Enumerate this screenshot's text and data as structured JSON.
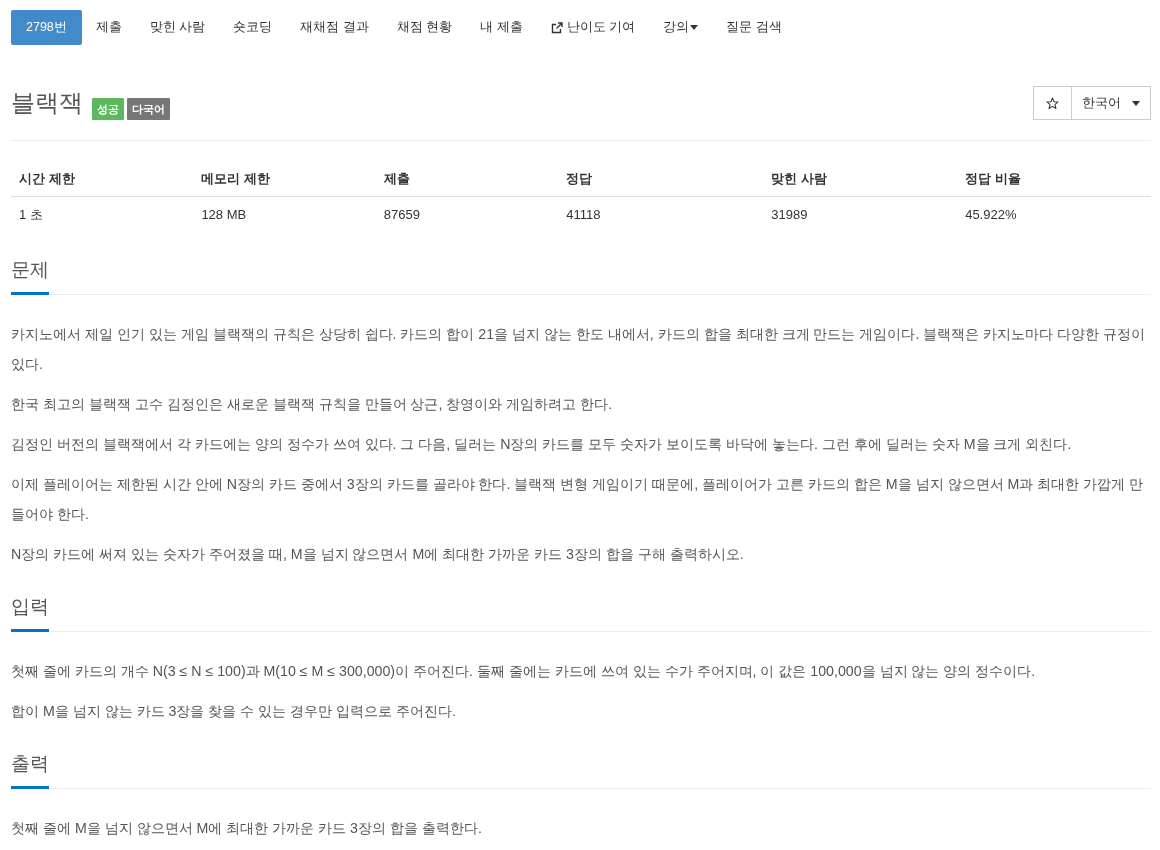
{
  "nav_tabs": [
    {
      "label": "2798번",
      "kind": "link",
      "selected": true
    },
    {
      "label": "제출",
      "kind": "link",
      "selected": false
    },
    {
      "label": "맞힌 사람",
      "kind": "link",
      "selected": false
    },
    {
      "label": "숏코딩",
      "kind": "link",
      "selected": false
    },
    {
      "label": "재채점 결과",
      "kind": "link",
      "selected": false
    },
    {
      "label": "채점 현황",
      "kind": "link",
      "selected": false
    },
    {
      "label": "내 제출",
      "kind": "link",
      "selected": false
    },
    {
      "label": "난이도 기여",
      "kind": "external",
      "selected": false
    },
    {
      "label": "강의",
      "kind": "dropdown",
      "selected": false
    },
    {
      "label": "질문 검색",
      "kind": "link",
      "selected": false
    }
  ],
  "problem_header": {
    "title": "블랙잭",
    "labels": [
      {
        "text": "성공",
        "color": "#5cb85c"
      },
      {
        "text": "다국어",
        "color": "#777777"
      }
    ],
    "star_button": {
      "starred": false
    },
    "language_select": {
      "value": "한국어"
    }
  },
  "info_table": {
    "columns": [
      "시간 제한",
      "메모리 제한",
      "제출",
      "정답",
      "맞힌 사람",
      "정답 비율"
    ],
    "rows": [
      [
        "1 초",
        "128 MB",
        "87659",
        "41118",
        "31989",
        "45.922%"
      ]
    ]
  },
  "sections": [
    {
      "heading": "문제",
      "paragraphs": [
        "카지노에서 제일 인기 있는 게임 블랙잭의 규칙은 상당히 쉽다. 카드의 합이 21을 넘지 않는 한도 내에서, 카드의 합을 최대한 크게 만드는 게임이다. 블랙잭은 카지노마다 다양한 규정이 있다.",
        "한국 최고의 블랙잭 고수 김정인은 새로운 블랙잭 규칙을 만들어 상근, 창영이와 게임하려고 한다.",
        "김정인 버전의 블랙잭에서 각 카드에는 양의 정수가 쓰여 있다. 그 다음, 딜러는 N장의 카드를 모두 숫자가 보이도록 바닥에 놓는다. 그런 후에 딜러는 숫자 M을 크게 외친다.",
        "이제 플레이어는 제한된 시간 안에 N장의 카드 중에서 3장의 카드를 골라야 한다. 블랙잭 변형 게임이기 때문에, 플레이어가 고른 카드의 합은 M을 넘지 않으면서 M과 최대한 가깝게 만들어야 한다.",
        "N장의 카드에 써져 있는 숫자가 주어졌을 때, M을 넘지 않으면서 M에 최대한 가까운 카드 3장의 합을 구해 출력하시오."
      ]
    },
    {
      "heading": "입력",
      "paragraphs": [
        "첫째 줄에 카드의 개수 N(3 ≤ N ≤ 100)과 M(10 ≤ M ≤ 300,000)이 주어진다. 둘째 줄에는 카드에 쓰여 있는 수가 주어지며, 이 값은 100,000을 넘지 않는 양의 정수이다.",
        "합이 M을 넘지 않는 카드 3장을 찾을 수 있는 경우만 입력으로 주어진다."
      ]
    },
    {
      "heading": "출력",
      "paragraphs": [
        "첫째 줄에 M을 넘지 않으면서 M에 최대한 가까운 카드 3장의 합을 출력한다."
      ]
    }
  ]
}
